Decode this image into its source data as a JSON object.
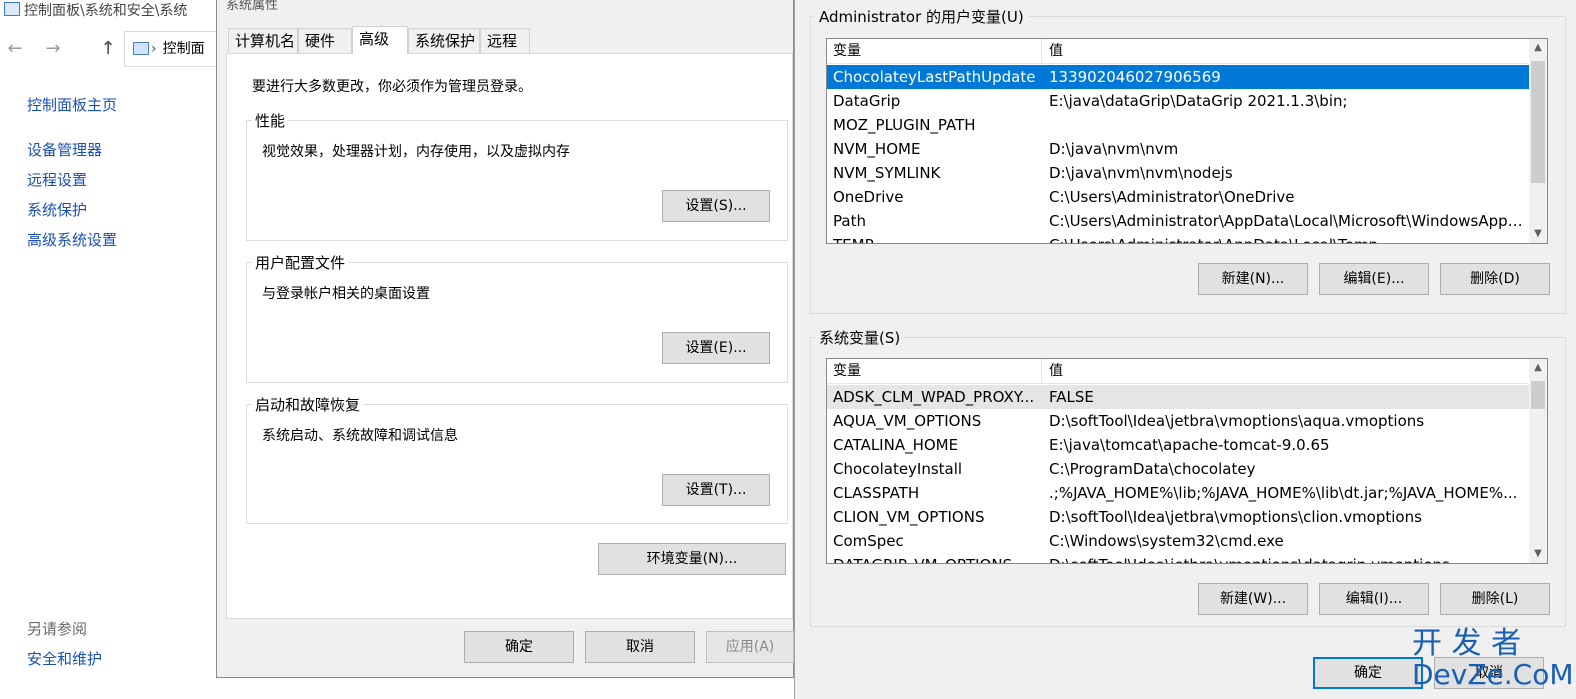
{
  "control_panel": {
    "title": "控制面板\\系统和安全\\系统",
    "nav_back": "←",
    "nav_forward": "→",
    "nav_up": "↑",
    "address": "控制面",
    "links": [
      "控制面板主页",
      "设备管理器",
      "远程设置",
      "系统保护",
      "高级系统设置"
    ],
    "see_also_heading": "另请参阅",
    "see_also_link": "安全和维护"
  },
  "system_properties": {
    "title": "系统属性",
    "tabs": [
      "计算机名",
      "硬件",
      "高级",
      "系统保护",
      "远程"
    ],
    "active_tab": "高级",
    "admin_note": "要进行大多数更改，你必须作为管理员登录。",
    "performance": {
      "label": "性能",
      "desc": "视觉效果，处理器计划，内存使用，以及虚拟内存",
      "button": "设置(S)..."
    },
    "user_profiles": {
      "label": "用户配置文件",
      "desc": "与登录帐户相关的桌面设置",
      "button": "设置(E)..."
    },
    "startup_recovery": {
      "label": "启动和故障恢复",
      "desc": "系统启动、系统故障和调试信息",
      "button": "设置(T)..."
    },
    "env_button": "环境变量(N)...",
    "ok": "确定",
    "cancel": "取消",
    "apply": "应用(A)"
  },
  "env_vars": {
    "user_section_label": "Administrator 的用户变量(U)",
    "system_section_label": "系统变量(S)",
    "col_var": "变量",
    "col_val": "值",
    "user_vars": [
      {
        "name": "ChocolateyLastPathUpdate",
        "value": "133902046027906569"
      },
      {
        "name": "DataGrip",
        "value": "E:\\java\\dataGrip\\DataGrip 2021.1.3\\bin;"
      },
      {
        "name": "MOZ_PLUGIN_PATH",
        "value": ""
      },
      {
        "name": "NVM_HOME",
        "value": "D:\\java\\nvm\\nvm"
      },
      {
        "name": "NVM_SYMLINK",
        "value": "D:\\java\\nvm\\nvm\\nodejs"
      },
      {
        "name": "OneDrive",
        "value": "C:\\Users\\Administrator\\OneDrive"
      },
      {
        "name": "Path",
        "value": "C:\\Users\\Administrator\\AppData\\Local\\Microsoft\\WindowsApps..."
      },
      {
        "name": "TEMP",
        "value": "C:\\Users\\Administrator\\AppData\\Local\\Temp"
      }
    ],
    "system_vars": [
      {
        "name": "ADSK_CLM_WPAD_PROXY...",
        "value": "FALSE"
      },
      {
        "name": "AQUA_VM_OPTIONS",
        "value": "D:\\softTool\\Idea\\jetbra\\vmoptions\\aqua.vmoptions"
      },
      {
        "name": "CATALINA_HOME",
        "value": "E:\\java\\tomcat\\apache-tomcat-9.0.65"
      },
      {
        "name": "ChocolateyInstall",
        "value": "C:\\ProgramData\\chocolatey"
      },
      {
        "name": "CLASSPATH",
        "value": ".;%JAVA_HOME%\\lib;%JAVA_HOME%\\lib\\dt.jar;%JAVA_HOME%..."
      },
      {
        "name": "CLION_VM_OPTIONS",
        "value": "D:\\softTool\\Idea\\jetbra\\vmoptions\\clion.vmoptions"
      },
      {
        "name": "ComSpec",
        "value": "C:\\Windows\\system32\\cmd.exe"
      },
      {
        "name": "DATAGRIP_VM_OPTIONS",
        "value": "D:\\softTool\\Idea\\jetbra\\vmoptions\\datagrip.vmoptions"
      }
    ],
    "user_buttons": {
      "new": "新建(N)...",
      "edit": "编辑(E)...",
      "delete": "删除(D)"
    },
    "system_buttons": {
      "new": "新建(W)...",
      "edit": "编辑(I)...",
      "delete": "删除(L)"
    },
    "ok": "确定",
    "cancel": "取消"
  },
  "watermark": {
    "line1": "开 发 者",
    "line2": "DevZe.CoM"
  }
}
